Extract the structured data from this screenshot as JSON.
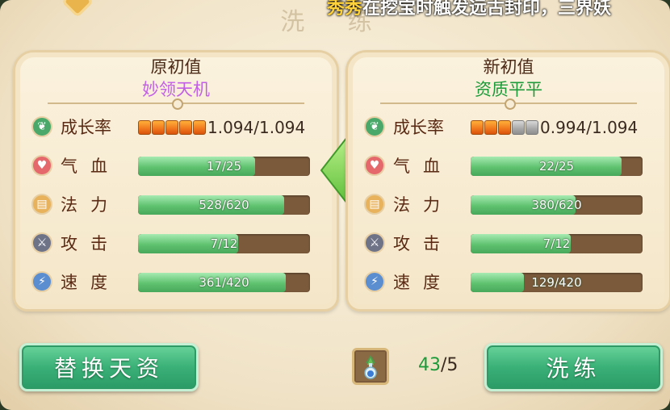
{
  "window": {
    "title": "洗 练"
  },
  "marquee": {
    "name": "秀秀",
    "text": "在挖宝时触发远古封印，三界妖"
  },
  "left_panel": {
    "header": "原初值",
    "quality": "妙领天机",
    "stats": [
      {
        "key": "growth",
        "label": "成长率",
        "value_text": "1.094/1.094",
        "pips_on": 5,
        "pips_total": 5,
        "icon": "sprout-icon"
      },
      {
        "key": "hp",
        "label": "气血",
        "value_text": "17/25",
        "fill": 0.68,
        "icon": "heart-icon"
      },
      {
        "key": "mp",
        "label": "法力",
        "value_text": "528/620",
        "fill": 0.85,
        "icon": "scroll-icon"
      },
      {
        "key": "atk",
        "label": "攻击",
        "value_text": "7/12",
        "fill": 0.58,
        "icon": "sword-icon"
      },
      {
        "key": "spd",
        "label": "速度",
        "value_text": "361/420",
        "fill": 0.86,
        "icon": "lightning-icon"
      }
    ]
  },
  "right_panel": {
    "header": "新初值",
    "quality": "资质平平",
    "stats": [
      {
        "key": "growth",
        "label": "成长率",
        "value_text": "0.994/1.094",
        "pips_on": 3,
        "pips_total": 5,
        "icon": "sprout-icon"
      },
      {
        "key": "hp",
        "label": "气血",
        "value_text": "22/25",
        "fill": 0.88,
        "icon": "heart-icon"
      },
      {
        "key": "mp",
        "label": "法力",
        "value_text": "380/620",
        "fill": 0.61,
        "icon": "scroll-icon"
      },
      {
        "key": "atk",
        "label": "攻击",
        "value_text": "7/12",
        "fill": 0.58,
        "icon": "sword-icon"
      },
      {
        "key": "spd",
        "label": "速度",
        "value_text": "129/420",
        "fill": 0.31,
        "icon": "lightning-icon"
      }
    ]
  },
  "buttons": {
    "replace": "替换天资",
    "reroll": "洗练"
  },
  "item": {
    "icon": "potion-bottle-icon",
    "have": "43",
    "need": "5"
  },
  "colors": {
    "accent_green": "#3ab077",
    "quality_purple": "#c25fe6",
    "quality_green": "#1e9a3a",
    "pip_orange": "#f0761c"
  }
}
